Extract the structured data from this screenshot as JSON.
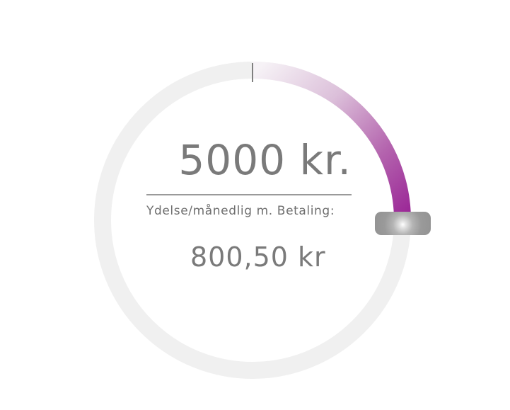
{
  "slider": {
    "amount": "5000 kr.",
    "fraction": 0.25
  },
  "payment": {
    "label": "Ydelse/månedlig m. Betaling:",
    "value": "800,50 kr"
  },
  "colors": {
    "track": "#f0f0f0",
    "accent": "#9a2596",
    "accent_light": "#f4eef4",
    "text": "#7a7a7a",
    "knob": "#999999",
    "tick": "#808080"
  }
}
